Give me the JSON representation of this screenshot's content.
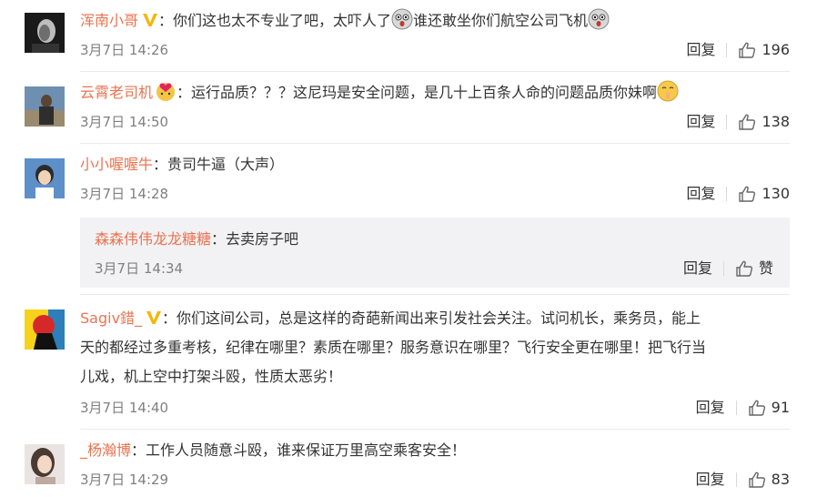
{
  "comments": [
    {
      "user": "浑南小哥",
      "verified": true,
      "text_part1": "：你们这也太不专业了吧，太吓人了",
      "text_part2": "谁还敢坐你们航空公司飞机",
      "time": "3月7日 14:26",
      "reply_label": "回复",
      "likes": "196"
    },
    {
      "user": "云霄老司机",
      "text": "：运行品质？？？这尼玛是安全问题，是几十上百条人命的问题品质你妹啊",
      "time": "3月7日 14:50",
      "reply_label": "回复",
      "likes": "138"
    },
    {
      "user": "小小喔喔牛",
      "text": "：贵司牛逼（大声）",
      "time": "3月7日 14:28",
      "reply_label": "回复",
      "likes": "130",
      "sub_reply": {
        "user": "森森伟伟龙龙糖糖",
        "text": "：去卖房子吧",
        "time": "3月7日 14:34",
        "reply_label": "回复",
        "like_label": "赞"
      }
    },
    {
      "user": "Sagiv錯_",
      "verified": true,
      "text_line1": "：你们这间公司，总是这样的奇葩新闻出来引发社会关注。试问机长，乘务员，能上",
      "text_line2": "天的都经过多重考核，纪律在哪里？素质在哪里？服务意识在哪里？飞行安全更在哪里！把飞行当",
      "text_line3": "儿戏，机上空中打架斗殴，性质太恶劣！",
      "time": "3月7日 14:40",
      "reply_label": "回复",
      "likes": "91"
    },
    {
      "user": "_杨瀚博",
      "text": "：工作人员随意斗殴，谁来保证万里高空乘客安全！",
      "time": "3月7日 14:29",
      "reply_label": "回复",
      "likes": "83"
    }
  ],
  "colors": {
    "username": "#eb7350",
    "verified": "#f7b500",
    "meta": "#808080",
    "subbox": "#f2f2f5"
  },
  "icons": [
    "thumbs-up-icon",
    "verified-v-icon",
    "shocked-emoji-icon",
    "shush-emoji-icon",
    "heart-face-emoji-icon"
  ]
}
